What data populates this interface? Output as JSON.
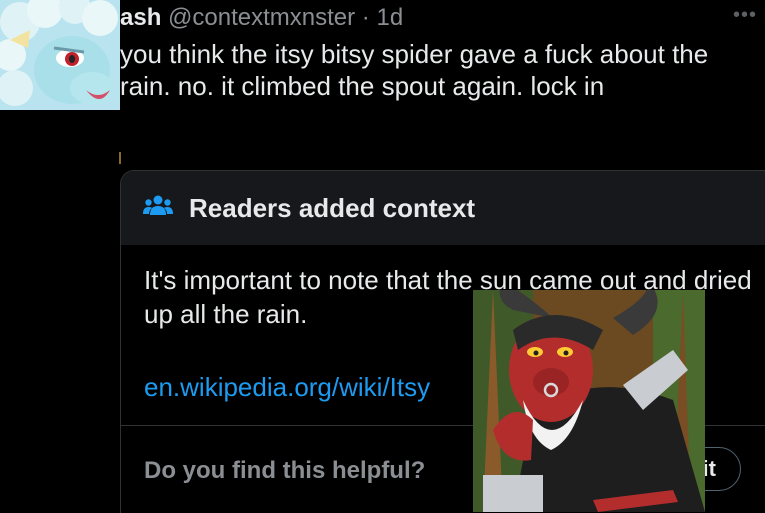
{
  "tweet": {
    "display_name": "ash",
    "handle": "@contextmxnster",
    "separator": "·",
    "time": "1d",
    "more_label": "•••",
    "text": "you think the itsy bitsy spider gave a fuck about the rain. no. it climbed the spout again. lock in"
  },
  "context": {
    "title": "Readers added context",
    "body": "It's important to note that the sun came out and dried up all the rain.",
    "link": "en.wikipedia.org/wiki/Itsy",
    "helpful_prompt": "Do you find this helpful?",
    "rate_label": "Rate it",
    "icon": "people-icon"
  },
  "colors": {
    "background": "#000000",
    "text": "#e7e9ea",
    "muted": "#8b8f94",
    "link": "#1d9bf0",
    "context_icon": "#1d9bf0"
  }
}
